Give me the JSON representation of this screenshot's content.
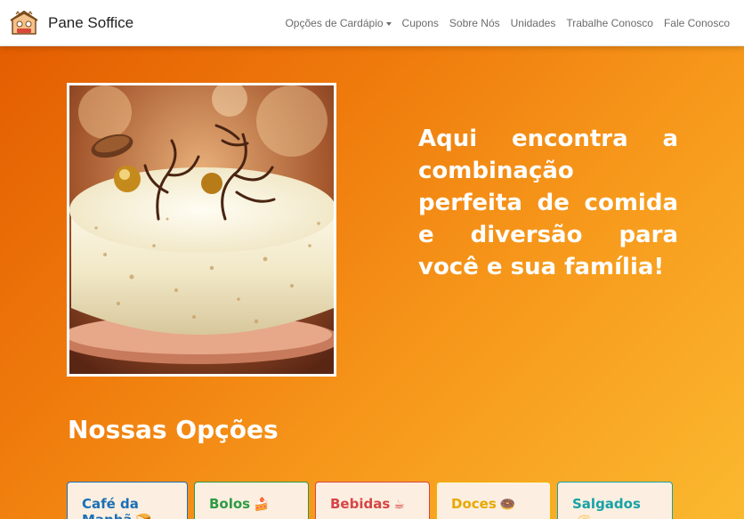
{
  "brand": {
    "name": "Pane Soffice",
    "logo_icon": "bakery-logo-icon"
  },
  "nav": {
    "items": [
      {
        "label": "Opções de Cardápio",
        "dropdown": true
      },
      {
        "label": "Cupons"
      },
      {
        "label": "Sobre Nós"
      },
      {
        "label": "Unidades"
      },
      {
        "label": "Trabalhe Conosco"
      },
      {
        "label": "Fale Conosco"
      }
    ]
  },
  "hero": {
    "image": "cake-photo",
    "headline": "Aqui encontra a combinação perfeita de comida e diversão para você e sua família!"
  },
  "section": {
    "title": "Nossas Opções"
  },
  "categories": [
    {
      "label": "Café da Manhã",
      "emoji": "🍞",
      "color": "#1b6fb5",
      "border": "#1b6fb5"
    },
    {
      "label": "Bolos",
      "emoji": "🍰",
      "color": "#2e9a44",
      "border": "#2e9a44"
    },
    {
      "label": "Bebidas",
      "emoji": "☕",
      "color": "#d64545",
      "border": "#d64545"
    },
    {
      "label": "Doces",
      "emoji": "🍩",
      "color": "#e7a800",
      "border": "#f0b400"
    },
    {
      "label": "Salgados",
      "emoji": "🥟",
      "color": "#17a2a6",
      "border": "#17a2a6"
    }
  ]
}
